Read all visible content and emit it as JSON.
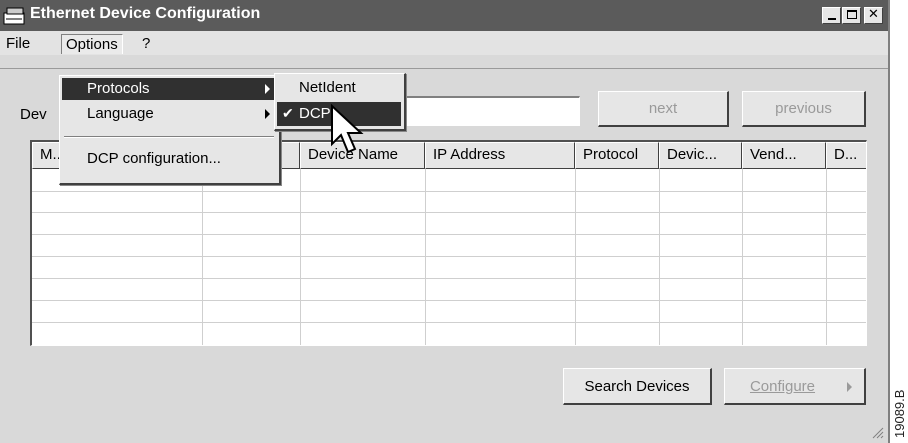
{
  "window": {
    "title": "Ethernet Device Configuration"
  },
  "menu": {
    "file": "File",
    "options": "Options",
    "help": "?"
  },
  "options_menu": {
    "protocols": "Protocols",
    "language": "Language",
    "dcp_configuration": "DCP configuration..."
  },
  "protocols_submenu": {
    "netident": "NetIdent",
    "dcp": "DCP",
    "dcp_checked": true
  },
  "device_label": "Dev",
  "buttons": {
    "next": "next",
    "previous": "previous",
    "search_devices": "Search Devices",
    "configure": "Configure"
  },
  "table": {
    "columns": [
      "M...",
      "",
      "Device Name",
      "IP Address",
      "Protocol",
      "Devic...",
      "Vend...",
      "D..."
    ],
    "rows": []
  },
  "figure_code": "19089.B"
}
